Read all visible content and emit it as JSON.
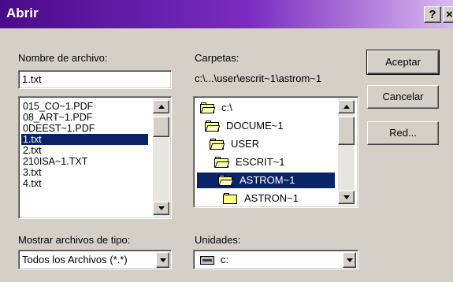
{
  "window": {
    "title": "Abrir",
    "help_button": "?",
    "close_button": "×"
  },
  "filename": {
    "label": "Nombre de archivo:",
    "value": "1.txt",
    "files": [
      "015_CO~1.PDF",
      "08_ART~1.PDF",
      "0DEEST~1.PDF",
      "1.txt",
      "2.txt",
      "210ISA~1.TXT",
      "3.txt",
      "4.txt"
    ],
    "selected_index": 3
  },
  "folders": {
    "label": "Carpetas:",
    "path": "c:\\...\\user\\escrit~1\\astrom~1",
    "tree": [
      "c:\\",
      "DOCUME~1",
      "USER",
      "ESCRIT~1",
      "ASTROM~1",
      "ASTRON~1"
    ],
    "selected_index": 4
  },
  "buttons": {
    "accept": "Aceptar",
    "cancel": "Cancelar",
    "network": "Red..."
  },
  "file_type": {
    "label": "Mostrar archivos de tipo:",
    "value": "Todos los Archivos (*.*)"
  },
  "drives": {
    "label": "Unidades:",
    "value": "c:"
  },
  "colors": {
    "title_start": "#4a0a8a",
    "title_end": "#d9b8ef",
    "selection": "#0a246a",
    "face": "#d4d0c8"
  }
}
